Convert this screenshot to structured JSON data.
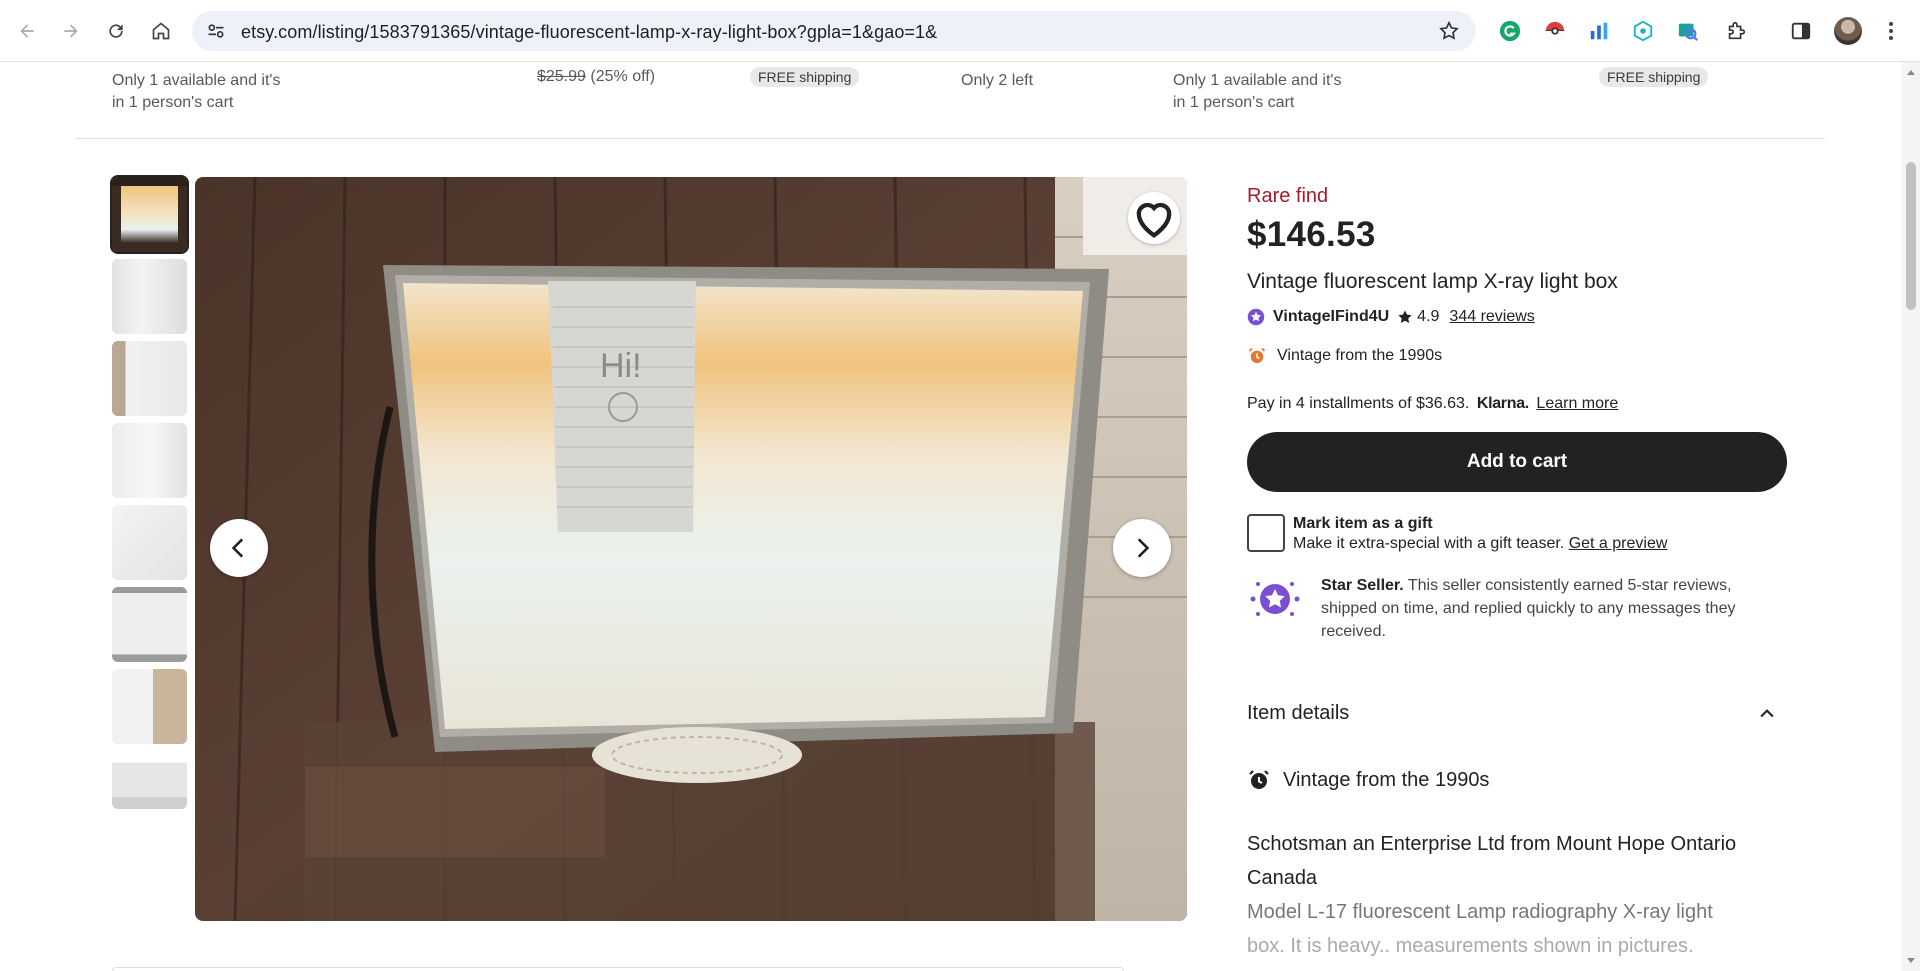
{
  "browser": {
    "url": "etsy.com/listing/1583791365/vintage-fluorescent-lamp-x-ray-light-box?gpla=1&gao=1&"
  },
  "recommendations": [
    {
      "line1": "Only 1 available and it's",
      "line2": "in 1 person's cart"
    },
    {
      "original_price": "$25.99",
      "discount": "(25% off)"
    },
    {
      "badge": "FREE shipping"
    },
    {
      "line1": "Only 2 left"
    },
    {
      "line1": "Only 1 available and it's",
      "line2": "in 1 person's cart"
    },
    {
      "badge": "FREE shipping"
    }
  ],
  "listing": {
    "rare_find": "Rare find",
    "price": "$146.53",
    "title": "Vintage fluorescent lamp X-ray light box",
    "seller_name": "VintageIFind4U",
    "rating": "4.9",
    "reviews": "344 reviews",
    "vintage_note": "Vintage from the 1990s",
    "installments": "Pay in 4 installments of $36.63.",
    "klarna": "Klarna.",
    "learn_more": "Learn more",
    "add_to_cart": "Add to cart",
    "gift_title": "Mark item as a gift",
    "gift_desc": "Make it extra-special with a gift teaser.",
    "gift_preview": "Get a preview",
    "star_seller_title": "Star Seller.",
    "star_seller_desc": "This seller consistently earned 5-star reviews, shipped on time, and replied quickly to any messages they received.",
    "item_details": "Item details",
    "detail_vintage": "Vintage from the 1990s",
    "description_1": "Schotsman an Enterprise Ltd from Mount Hope Ontario Canada",
    "description_2": "Model L-17 fluorescent Lamp radiography X-ray light",
    "description_3": "box. It is heavy.. measurements shown in pictures."
  },
  "colors": {
    "rare_find": "#a61a2e",
    "button_dark": "#222222",
    "star_seller_purple": "#7b4fd1"
  }
}
